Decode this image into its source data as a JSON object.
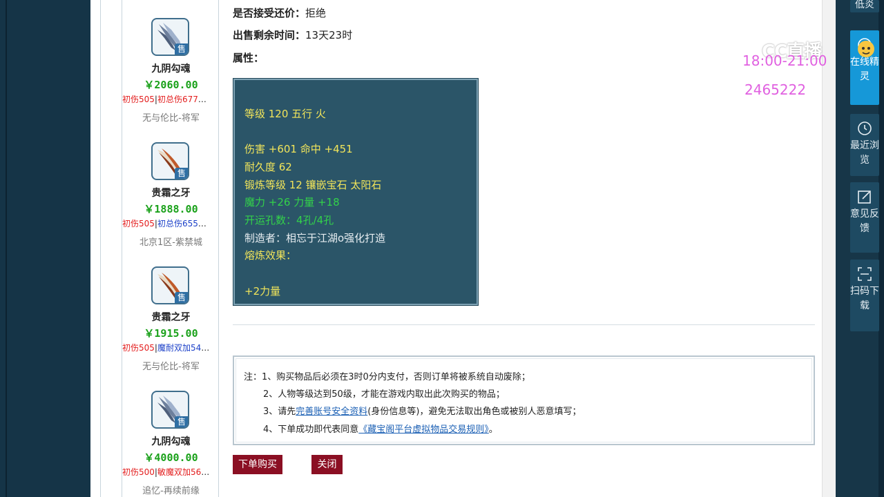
{
  "list": {
    "items": [
      {
        "name": "九阴勾魂",
        "price": "￥2060.00",
        "tag1": "初伤505",
        "tag2": "初总伤677",
        "more": "…",
        "server": "无与伦比-将军",
        "badge": "售"
      },
      {
        "name": "贵霜之牙",
        "price": "￥1888.00",
        "tag1": "初伤505",
        "tag2": "初总伤655",
        "more": "…",
        "server": "北京1区-紫禁城",
        "badge": "售"
      },
      {
        "name": "贵霜之牙",
        "price": "￥1915.00",
        "tag1": "初伤505",
        "tag2": "魔耐双加54",
        "more": "…",
        "server": "无与伦比-将军",
        "badge": "售"
      },
      {
        "name": "九阴勾魂",
        "price": "￥4000.00",
        "tag1": "初伤500",
        "tag2": "敏魔双加56",
        "more": "…",
        "server": "追忆-再续前缘",
        "badge": "售"
      }
    ]
  },
  "detail": {
    "counter_offer_label": "是否接受还价：",
    "counter_offer_value": "拒绝",
    "remaining_label": "出售剩余时间：",
    "remaining_value": "13天23时",
    "attr_label": "属性：",
    "attrs": {
      "level": "等级 120 五行 火",
      "damage": "伤害 +601 命中 +451",
      "durability": "耐久度 62",
      "forge": "锻炼等级 12 镶嵌宝石 太阳石",
      "magic": "魔力 +26 力量 +18",
      "holes": "开运孔数：4孔/4孔",
      "maker": "制造者：相忘于江湖o强化打造",
      "smelt": "熔炼效果：",
      "smelt_value": "+2力量"
    }
  },
  "notes": {
    "prefix": "注：",
    "n1": "1、购买物品后必须在3时0分内支付，否则订单将被系统自动废除；",
    "n2": "2、人物等级达到50级，才能在游戏内取出此次购买的物品；",
    "n3_pre": "3、请先",
    "n3_link": "完善账号安全资料",
    "n3_post": "(身份信息等)，避免无法取出角色或被别人恶意填写；",
    "n4_pre": "4、下单成功即代表同意",
    "n4_link": "《藏宝阁平台虚拟物品交易规则》",
    "n4_post": "。"
  },
  "buttons": {
    "buy": "下单购买",
    "close": "关闭"
  },
  "overlay": {
    "brand": "CC直播",
    "time": "18:00-21:00",
    "id": "2465222"
  },
  "toolbar": {
    "top_partial": "低炎",
    "online": "在线精灵",
    "recent": "最近浏览",
    "feedback": "意见反馈",
    "scan": "扫码下载"
  },
  "colors": {
    "attr_bg": "#2b5568",
    "price_green": "#1aa11a",
    "button_red": "#8b0f23",
    "overlay_pink": "#e060e0",
    "toolbar_active": "#1698d8"
  }
}
